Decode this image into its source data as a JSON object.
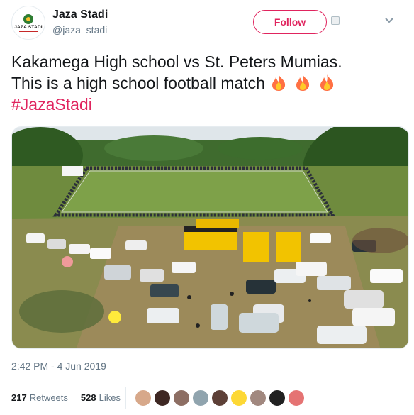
{
  "account": {
    "display_name": "Jaza Stadi",
    "handle": "@jaza_stadi",
    "avatar_text": "JAZA STADI",
    "avatar_icon": "football-logo-icon"
  },
  "header": {
    "follow_label": "Follow",
    "menu_icon": "chevron-down-icon"
  },
  "tweet": {
    "line1": "Kakamega High school vs St. Peters Mumias.",
    "line2": "This is a high school football match",
    "hashtag": "#JazaStadi",
    "emoji": "fire-emoji"
  },
  "media": {
    "type": "photo",
    "subject": "aerial-football-field-with-crowd-and-parked-cars"
  },
  "meta": {
    "timestamp": "2:42 PM - 4 Jun 2019"
  },
  "stats": {
    "retweets_count": "217",
    "retweets_label": "Retweets",
    "likes_count": "528",
    "likes_label": "Likes"
  },
  "likers": [
    {
      "color": "#d7a88a"
    },
    {
      "color": "#3e2723"
    },
    {
      "color": "#8d6e63"
    },
    {
      "color": "#90a4ae"
    },
    {
      "color": "#5d4037"
    },
    {
      "color": "#fdd835"
    },
    {
      "color": "#a1887f"
    },
    {
      "color": "#212121"
    },
    {
      "color": "#e57373"
    }
  ],
  "colors": {
    "accent": "#e0245e",
    "text": "#14171a",
    "muted": "#657786"
  }
}
